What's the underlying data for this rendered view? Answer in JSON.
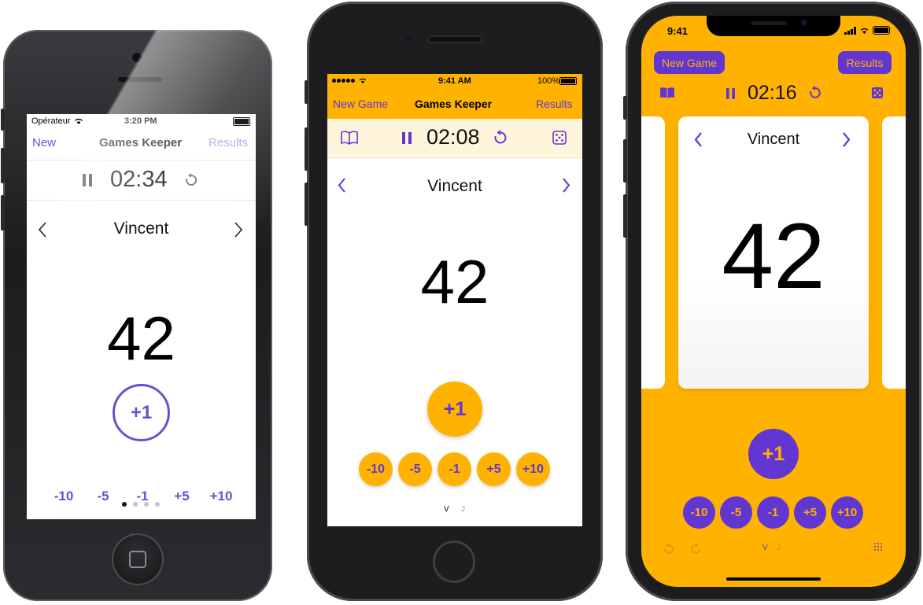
{
  "app_title": "Games Keeper",
  "player": "Vincent",
  "score": "42",
  "increments": {
    "main": "+1",
    "row": [
      "-10",
      "-5",
      "-1",
      "+5",
      "+10"
    ]
  },
  "phone1": {
    "carrier": "Opérateur",
    "time": "3:20 PM",
    "nav_left": "New",
    "nav_title": "Games Keeper",
    "nav_right": "Results",
    "timer": "02:34",
    "page_dots": 4
  },
  "phone2": {
    "time": "9:41 AM",
    "battery": "100%",
    "nav_left": "New Game",
    "nav_title": "Games Keeper",
    "nav_right": "Results",
    "timer": "02:08",
    "players_initials": [
      "V",
      "J"
    ]
  },
  "phone3": {
    "time": "9:41",
    "new_game": "New Game",
    "results": "Results",
    "timer": "02:16",
    "players_initials": [
      "V",
      "J"
    ]
  },
  "colors": {
    "purple": "#6236d1",
    "amber": "#ffb300",
    "amber_light": "#fff5dc"
  }
}
